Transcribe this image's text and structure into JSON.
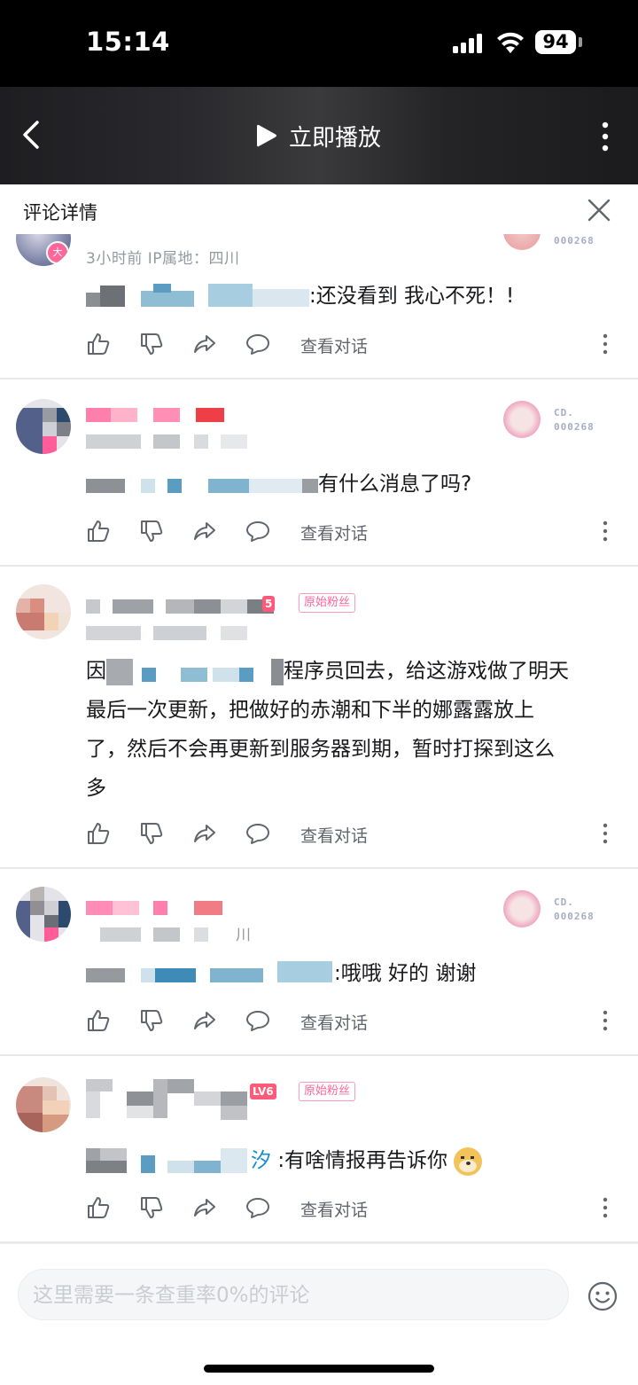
{
  "status_bar": {
    "time": "15:14",
    "battery": "94"
  },
  "header": {
    "play_label": "立即播放"
  },
  "panel": {
    "title": "评论详情"
  },
  "comments": [
    {
      "meta": "3小时前  IP属地：四川",
      "text": ":还没看到 我心不死！!",
      "view_label": "查看对话",
      "badge_num": "000268"
    },
    {
      "badge_prefix": "CD.",
      "badge_num": "000268",
      "text": "有什么消息了吗?",
      "view_label": "查看对话"
    },
    {
      "badge_fan": "原始粉丝",
      "lv_badge": "5",
      "text_lines": [
        "程序员回去，给这游戏做了明天",
        "最后一次更新，把做好的赤潮和下半的娜露露放上",
        "了，然后不会再更新到服务器到期，暂时打探到这么",
        "多"
      ],
      "text_first_char": "因",
      "view_label": "查看对话"
    },
    {
      "badge_prefix": "CD.",
      "badge_num": "000268",
      "text": ":哦哦  好的 谢谢",
      "view_label": "查看对话",
      "meta_tail": "川"
    },
    {
      "badge_fan": "原始粉丝",
      "lv_badge": "LV6",
      "text_name_tail": "汐",
      "text": ":有啥情报再告诉你",
      "view_label": "查看对话"
    }
  ],
  "input": {
    "placeholder": "这里需要一条查重率0%的评论"
  },
  "colors": {
    "accent_pink": "#ff6699",
    "text_primary": "#18191c",
    "text_secondary": "#9499a0",
    "divider": "#e8e8ea"
  }
}
